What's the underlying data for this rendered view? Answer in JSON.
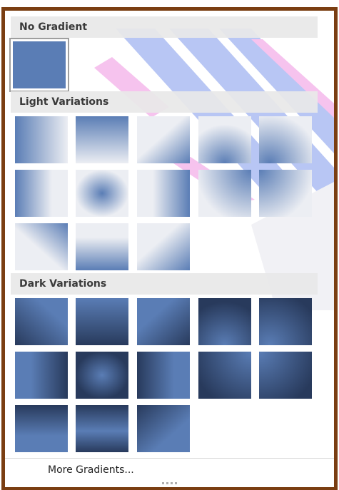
{
  "header_no_gradient": "No Gradient",
  "header_light": "Light Variations",
  "header_dark": "Dark Variations",
  "more_label": "More Gradients...",
  "base_color": "#5a7db5",
  "dark_color": "#283a5c",
  "light_color": "#eceef3",
  "frame_color": "#7a3e12",
  "light_swatches": [
    "linear-right-to-left",
    "linear-top-to-bottom",
    "linear-diagonal-top-left",
    "radial-bottom",
    "radial-bottom-right",
    "linear-left-edge",
    "rectangular-center",
    "linear-right-edge",
    "radial-top-right",
    "radial-top-left",
    "linear-diagonal-bottom-left",
    "linear-bottom-edge",
    "linear-diagonal-bottom-right"
  ],
  "dark_swatches": [
    "linear-diagonal-1",
    "linear-bottom",
    "linear-diagonal-2",
    "radial-dark-1",
    "radial-dark-2",
    "linear-side-1",
    "rectangular-center",
    "linear-side-2",
    "radial-dark-3",
    "radial-dark-4",
    "linear-top",
    "linear-bottom-2",
    "linear-diagonal-3"
  ]
}
